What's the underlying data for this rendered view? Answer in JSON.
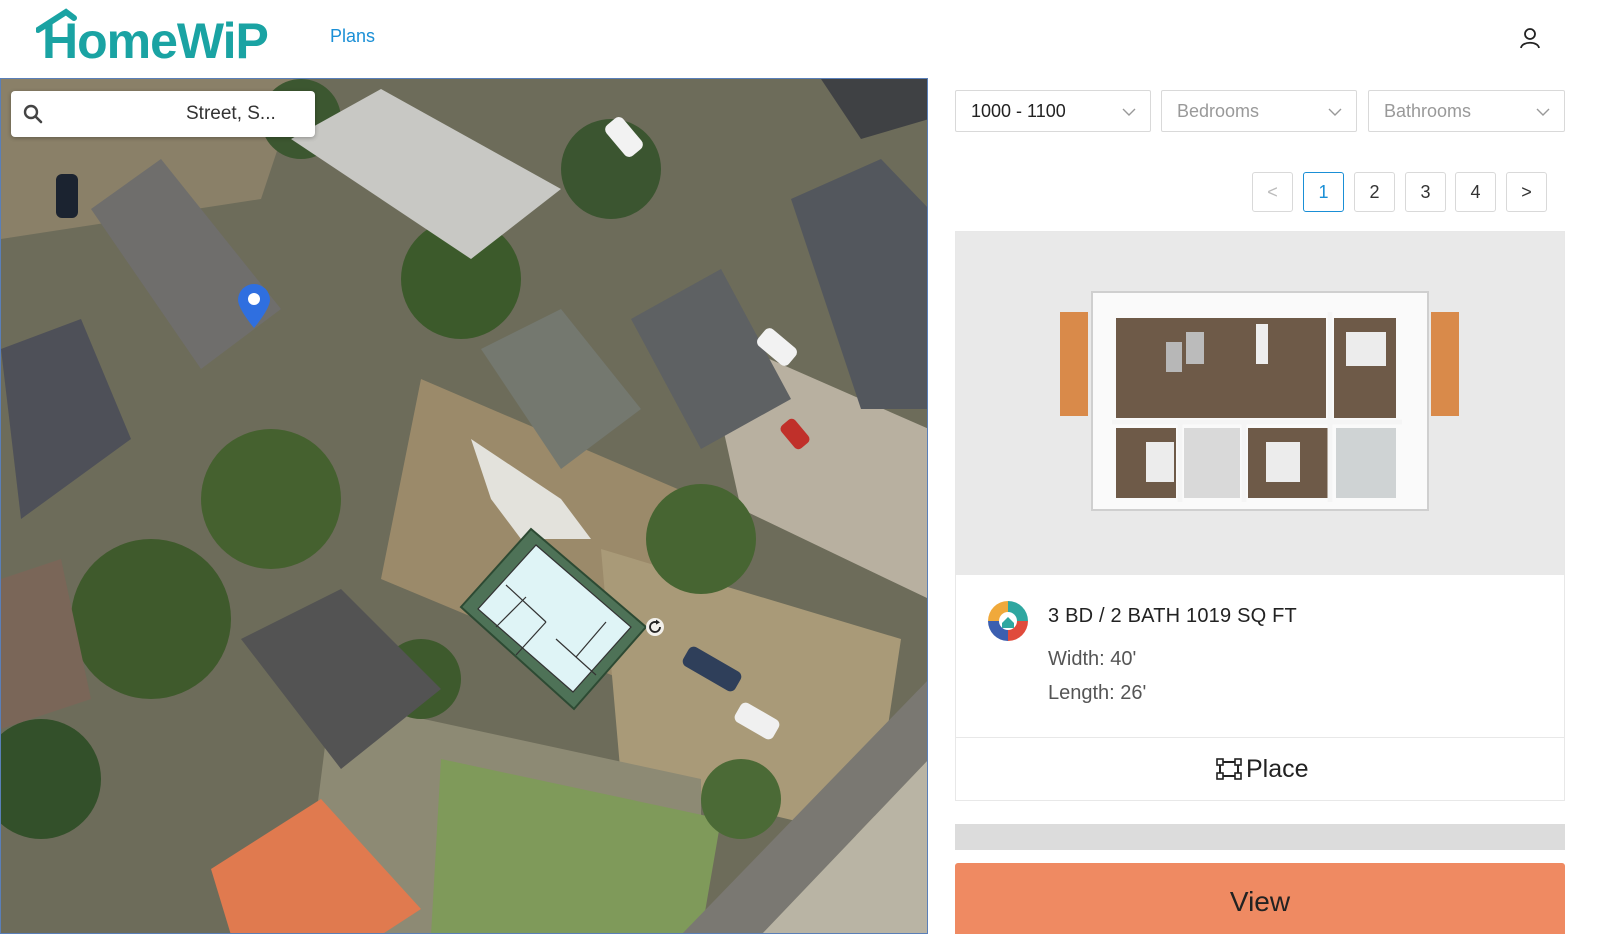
{
  "header": {
    "logo_text": "HomeWiP",
    "nav_plans": "Plans",
    "user_icon": "user-icon"
  },
  "map": {
    "search": {
      "icon": "search-icon",
      "text": "Street, S..."
    },
    "pin_icon": "map-pin-icon",
    "rotate_icon": "rotate-icon"
  },
  "filters": {
    "size": "1000 - 1100",
    "bedrooms_placeholder": "Bedrooms",
    "bathrooms_placeholder": "Bathrooms"
  },
  "pagination": {
    "prev": "<",
    "pages": [
      "1",
      "2",
      "3",
      "4"
    ],
    "next": ">",
    "current": "1"
  },
  "plan_card": {
    "title": "3 BD / 2 BATH 1019 SQ FT",
    "width": "Width: 40'",
    "length": "Length: 26'",
    "place_label": "Place",
    "place_icon": "place-frame-icon"
  },
  "view_button": "View",
  "colors": {
    "brand_teal": "#1aa3a3",
    "link_blue": "#1a8fd6",
    "view_orange": "#ef8a62"
  }
}
